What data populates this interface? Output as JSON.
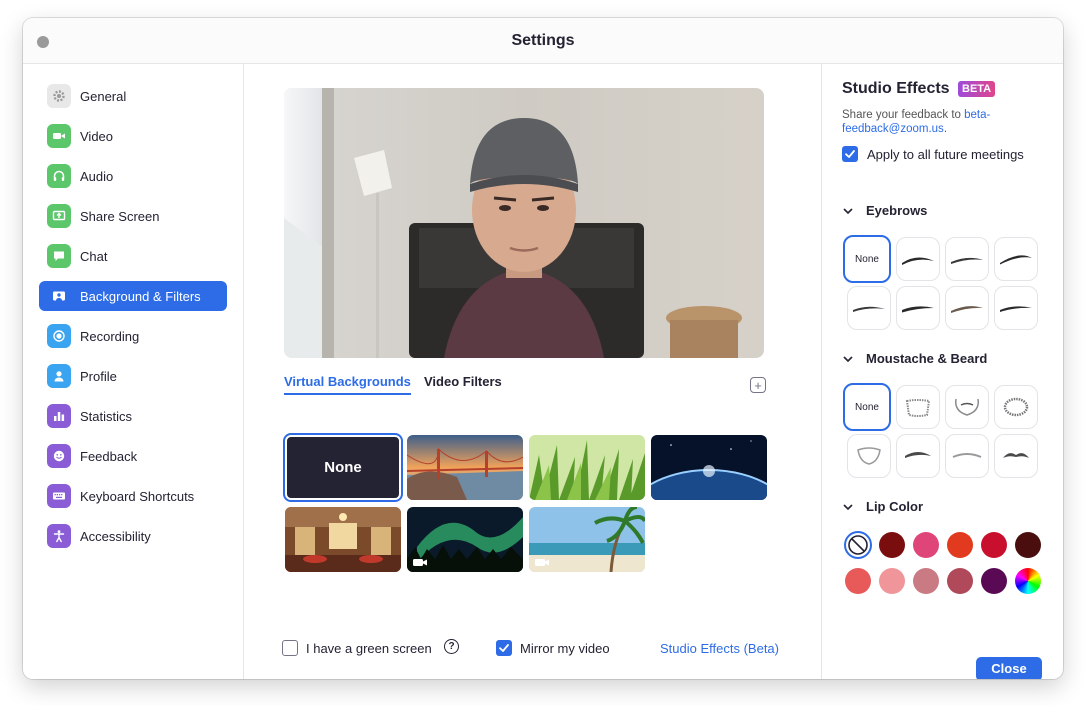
{
  "window": {
    "title": "Settings"
  },
  "sidebar": {
    "items": [
      {
        "label": "General",
        "icon": "gear-icon",
        "color": "#e6e6e6"
      },
      {
        "label": "Video",
        "icon": "video-camera-icon",
        "color": "#5cc66a"
      },
      {
        "label": "Audio",
        "icon": "headphones-icon",
        "color": "#5cc66a"
      },
      {
        "label": "Share Screen",
        "icon": "share-screen-icon",
        "color": "#5cc66a"
      },
      {
        "label": "Chat",
        "icon": "chat-bubble-icon",
        "color": "#5cc66a"
      },
      {
        "label": "Background & Filters",
        "icon": "background-icon",
        "color": "#2d6ce6",
        "active": true
      },
      {
        "label": "Recording",
        "icon": "record-icon",
        "color": "#3aa4f0"
      },
      {
        "label": "Profile",
        "icon": "person-icon",
        "color": "#3aa4f0"
      },
      {
        "label": "Statistics",
        "icon": "bar-chart-icon",
        "color": "#8a5cd6"
      },
      {
        "label": "Feedback",
        "icon": "smiley-icon",
        "color": "#8a5cd6"
      },
      {
        "label": "Keyboard Shortcuts",
        "icon": "keyboard-icon",
        "color": "#8a5cd6"
      },
      {
        "label": "Accessibility",
        "icon": "accessibility-icon",
        "color": "#8a5cd6"
      }
    ]
  },
  "main": {
    "tabs": [
      {
        "label": "Virtual Backgrounds",
        "active": true
      },
      {
        "label": "Video Filters",
        "active": false
      }
    ],
    "backgrounds": [
      {
        "label": "None",
        "selected": true
      },
      {
        "name": "golden-gate-bridge"
      },
      {
        "name": "grass"
      },
      {
        "name": "earth-from-space"
      },
      {
        "name": "lobby-interior"
      },
      {
        "name": "aurora",
        "video": true
      },
      {
        "name": "beach-palm",
        "video": true
      }
    ],
    "green_screen_label": "I have a green screen",
    "green_screen_checked": false,
    "mirror_label": "Mirror my video",
    "mirror_checked": true,
    "studio_link": "Studio Effects (Beta)"
  },
  "studio": {
    "title": "Studio Effects",
    "beta_badge": "BETA",
    "feedback_prefix": "Share your feedback to ",
    "feedback_email": "beta-feedback@zoom.us",
    "feedback_suffix": ".",
    "apply_label": "Apply to all future meetings",
    "apply_checked": true,
    "eyebrows_title": "Eyebrows",
    "moustache_title": "Moustache & Beard",
    "lip_title": "Lip Color",
    "none_label": "None",
    "lip_colors": [
      "#7a0e0e",
      "#e0457a",
      "#e23a1e",
      "#c8102e",
      "#4a0e0e",
      "#e85a5a",
      "#f0959a",
      "#c97a82",
      "#b04a5a",
      "#5a0a55"
    ],
    "close_label": "Close"
  }
}
